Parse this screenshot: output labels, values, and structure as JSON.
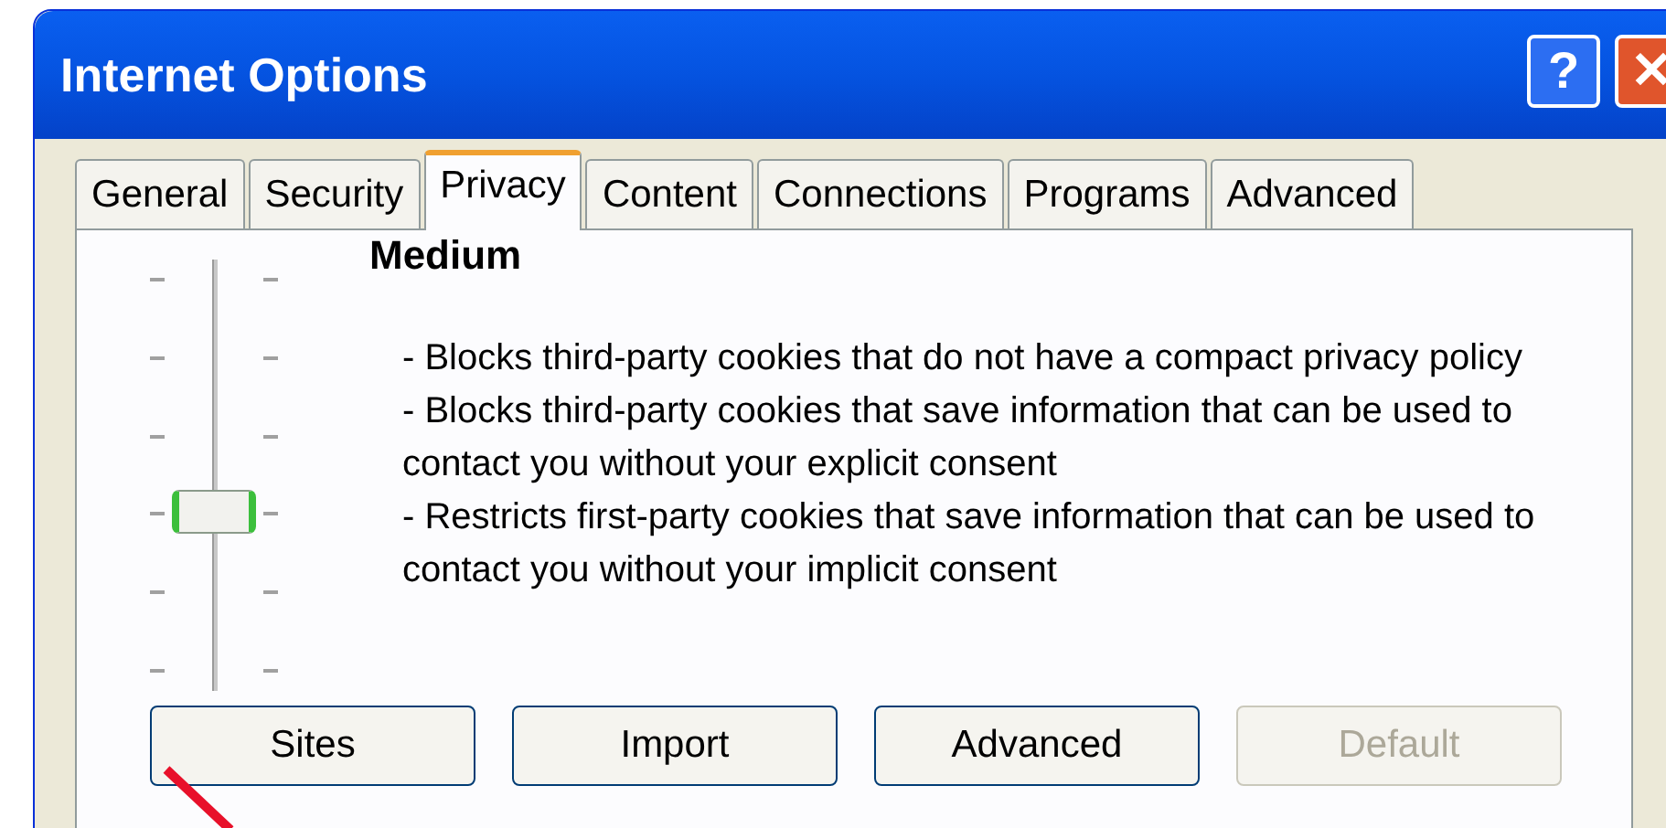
{
  "window": {
    "title": "Internet Options",
    "buttons": [
      {
        "kind": "help",
        "label": "?"
      },
      {
        "kind": "close",
        "label": "✕"
      }
    ]
  },
  "tabs": [
    {
      "label": "General",
      "selected": false
    },
    {
      "label": "Security",
      "selected": false
    },
    {
      "label": "Privacy",
      "selected": true
    },
    {
      "label": "Content",
      "selected": false
    },
    {
      "label": "Connections",
      "selected": false
    },
    {
      "label": "Programs",
      "selected": false
    },
    {
      "label": "Advanced",
      "selected": false
    }
  ],
  "privacy": {
    "setting": "Medium",
    "slider": {
      "level": 0.4
    },
    "description": [
      "- Blocks third-party cookies that do not have a compact privacy policy",
      "- Blocks third-party cookies that save information that can be used to contact you without your explicit consent",
      "- Restricts first-party cookies that save information that can be used to contact you without your implicit consent"
    ],
    "buttons": [
      {
        "label": "Sites",
        "disabled": false
      },
      {
        "label": "Import",
        "disabled": false
      },
      {
        "label": "Advanced",
        "disabled": false
      },
      {
        "label": "Default",
        "disabled": true
      }
    ]
  }
}
